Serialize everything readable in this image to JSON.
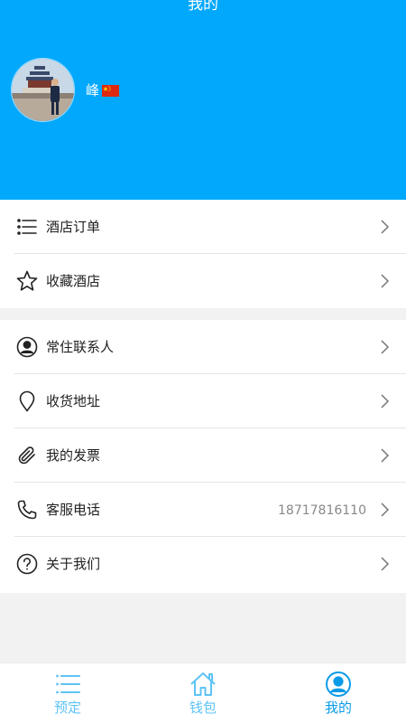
{
  "header": {
    "title": "我的",
    "username": "峰",
    "flag_icon": "china-flag-emoji",
    "background_color": "#02a8fc"
  },
  "menu_group_1": [
    {
      "icon": "list-icon",
      "label": "酒店订单"
    },
    {
      "icon": "star-icon",
      "label": "收藏酒店"
    }
  ],
  "menu_group_2": [
    {
      "icon": "user-circle-icon",
      "label": "常住联系人"
    },
    {
      "icon": "location-pin-icon",
      "label": "收货地址"
    },
    {
      "icon": "paperclip-icon",
      "label": "我的发票"
    },
    {
      "icon": "phone-icon",
      "label": "客服电话",
      "value": "18717816110"
    },
    {
      "icon": "question-circle-icon",
      "label": "关于我们"
    }
  ],
  "tabbar": {
    "tabs": [
      {
        "icon": "list-icon",
        "label": "预定",
        "active": false
      },
      {
        "icon": "home-icon",
        "label": "钱包",
        "active": false
      },
      {
        "icon": "user-circle-icon",
        "label": "我的",
        "active": true
      }
    ],
    "inactive_color": "#5ec3f5",
    "active_color": "#0a9be8"
  }
}
